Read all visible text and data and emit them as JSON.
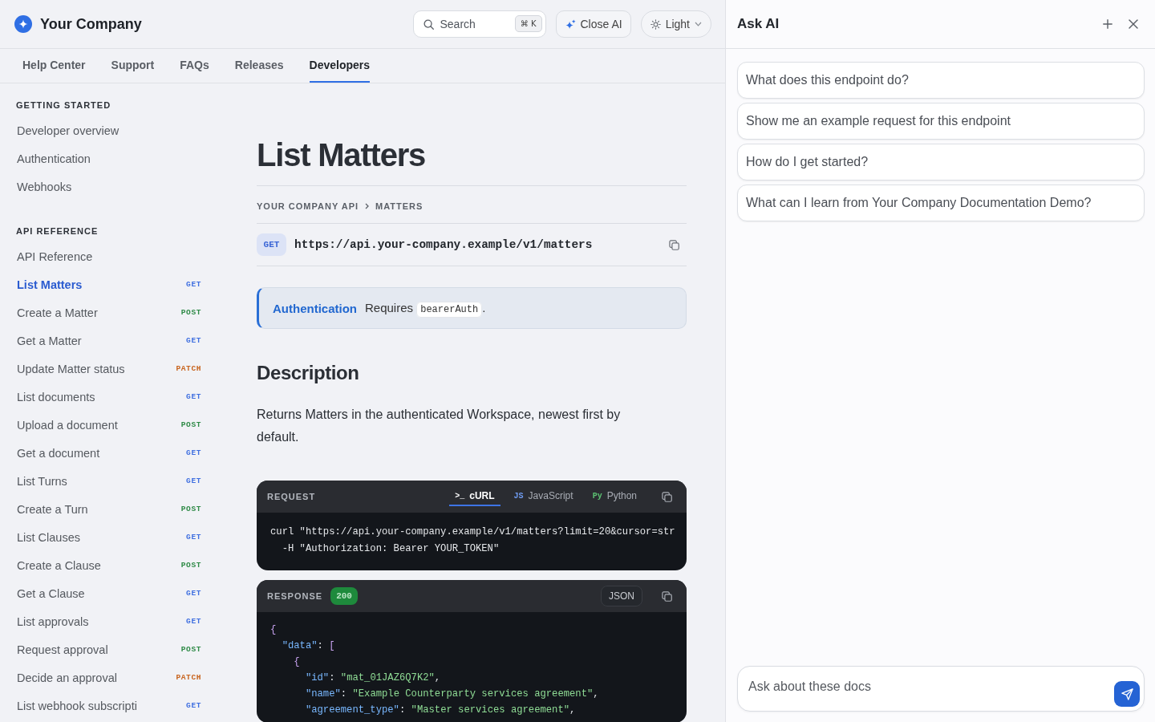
{
  "header": {
    "brand": "Your Company",
    "search": {
      "placeholder": "Search",
      "shortcut": "⌘ K"
    },
    "close_ai": "Close AI",
    "theme": "Light"
  },
  "nav_tabs": [
    {
      "label": "Help Center",
      "selected": false
    },
    {
      "label": "Support",
      "selected": false
    },
    {
      "label": "FAQs",
      "selected": false
    },
    {
      "label": "Releases",
      "selected": false
    },
    {
      "label": "Developers",
      "selected": true
    }
  ],
  "sidebar": {
    "sections": [
      {
        "title": "GETTING STARTED",
        "items": [
          {
            "label": "Developer overview",
            "selected": false
          },
          {
            "label": "Authentication",
            "selected": false
          },
          {
            "label": "Webhooks",
            "selected": false
          }
        ]
      },
      {
        "title": "API REFERENCE",
        "items": [
          {
            "label": "API Reference",
            "selected": false
          },
          {
            "label": "List Matters",
            "selected": true,
            "method": {
              "text": "GET",
              "color": "#3f6fe0"
            }
          },
          {
            "label": "Create a Matter",
            "selected": false,
            "method": {
              "text": "POST",
              "color": "#2e8a46"
            }
          },
          {
            "label": "Get a Matter",
            "selected": false,
            "method": {
              "text": "GET",
              "color": "#3f6fe0"
            }
          },
          {
            "label": "Update Matter status",
            "selected": false,
            "method": {
              "text": "PATCH",
              "color": "#c8641e"
            }
          },
          {
            "label": "List documents",
            "selected": false,
            "method": {
              "text": "GET",
              "color": "#3f6fe0"
            }
          },
          {
            "label": "Upload a document",
            "selected": false,
            "method": {
              "text": "POST",
              "color": "#2e8a46"
            }
          },
          {
            "label": "Get a document",
            "selected": false,
            "method": {
              "text": "GET",
              "color": "#3f6fe0"
            }
          },
          {
            "label": "List Turns",
            "selected": false,
            "method": {
              "text": "GET",
              "color": "#3f6fe0"
            }
          },
          {
            "label": "Create a Turn",
            "selected": false,
            "method": {
              "text": "POST",
              "color": "#2e8a46"
            }
          },
          {
            "label": "List Clauses",
            "selected": false,
            "method": {
              "text": "GET",
              "color": "#3f6fe0"
            }
          },
          {
            "label": "Create a Clause",
            "selected": false,
            "method": {
              "text": "POST",
              "color": "#2e8a46"
            }
          },
          {
            "label": "Get a Clause",
            "selected": false,
            "method": {
              "text": "GET",
              "color": "#3f6fe0"
            }
          },
          {
            "label": "List approvals",
            "selected": false,
            "method": {
              "text": "GET",
              "color": "#3f6fe0"
            }
          },
          {
            "label": "Request approval",
            "selected": false,
            "method": {
              "text": "POST",
              "color": "#2e8a46"
            }
          },
          {
            "label": "Decide an approval",
            "selected": false,
            "method": {
              "text": "PATCH",
              "color": "#c8641e"
            }
          },
          {
            "label": "List webhook subscripti",
            "selected": false,
            "method": {
              "text": "GET",
              "color": "#3f6fe0"
            }
          }
        ]
      }
    ]
  },
  "page": {
    "title": "List Matters",
    "breadcrumb": [
      "YOUR COMPANY API",
      "MATTERS"
    ],
    "endpoint": {
      "method": "GET",
      "url": "https://api.your-company.example/v1/matters"
    },
    "callout": {
      "title": "Authentication",
      "text_before": "Requires",
      "code": "bearerAuth",
      "text_after": "."
    },
    "description": {
      "heading": "Description",
      "text": "Returns Matters in the authenticated Workspace, newest first by default."
    },
    "request": {
      "title": "REQUEST",
      "tabs": [
        {
          "prefix": ">_",
          "label": "cURL",
          "color": "#ffffff",
          "selected": true
        },
        {
          "prefix": "JS",
          "label": "JavaScript",
          "color": "#6f9cf2",
          "selected": false
        },
        {
          "prefix": "Py",
          "label": "Python",
          "color": "#5cc172",
          "selected": false
        }
      ],
      "lines": [
        "curl \"https://api.your-company.example/v1/matters?limit=20&cursor=str",
        "  -H \"Authorization: Bearer YOUR_TOKEN\""
      ]
    },
    "response": {
      "title": "RESPONSE",
      "status": "200",
      "format": "JSON",
      "lines": [
        "{",
        "  \"data\": [",
        "    {",
        "      \"id\": \"mat_01JAZ6Q7K2\",",
        "      \"name\": \"Example Counterparty services agreement\",",
        "      \"agreement_type\": \"Master services agreement\","
      ]
    }
  },
  "ask_ai": {
    "title": "Ask AI",
    "suggestions": [
      "What does this endpoint do?",
      "Show me an example request for this endpoint",
      "How do I get started?",
      "What can I learn from Your Company Documentation Demo?"
    ],
    "input": {
      "placeholder": "Ask about these docs"
    }
  }
}
